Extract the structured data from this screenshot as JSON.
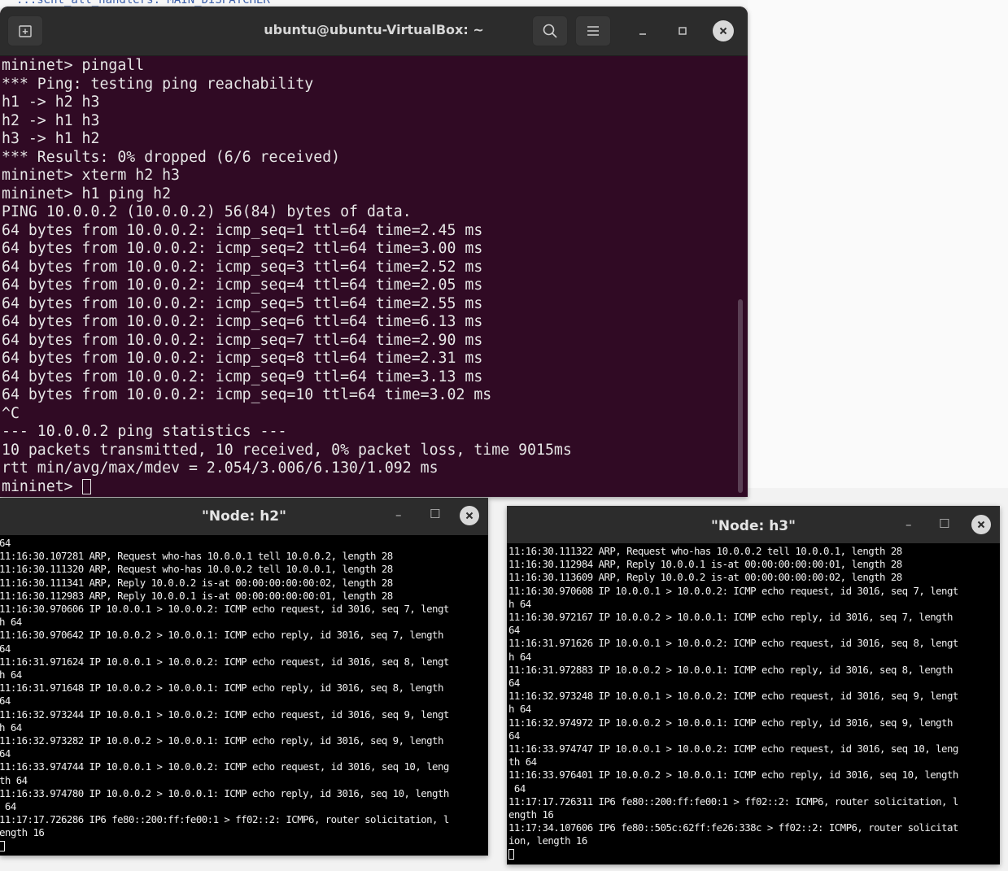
{
  "background": {
    "partial_text": "...sent_all_handlers: MAIN_DISPATCHER"
  },
  "terminal": {
    "title": "ubuntu@ubuntu-VirtualBox: ~",
    "lines": [
      "mininet> pingall",
      "*** Ping: testing ping reachability",
      "h1 -> h2 h3",
      "h2 -> h1 h3",
      "h3 -> h1 h2",
      "*** Results: 0% dropped (6/6 received)",
      "mininet> xterm h2 h3",
      "mininet> h1 ping h2",
      "PING 10.0.0.2 (10.0.0.2) 56(84) bytes of data.",
      "64 bytes from 10.0.0.2: icmp_seq=1 ttl=64 time=2.45 ms",
      "64 bytes from 10.0.0.2: icmp_seq=2 ttl=64 time=3.00 ms",
      "64 bytes from 10.0.0.2: icmp_seq=3 ttl=64 time=2.52 ms",
      "64 bytes from 10.0.0.2: icmp_seq=4 ttl=64 time=2.05 ms",
      "64 bytes from 10.0.0.2: icmp_seq=5 ttl=64 time=2.55 ms",
      "64 bytes from 10.0.0.2: icmp_seq=6 ttl=64 time=6.13 ms",
      "64 bytes from 10.0.0.2: icmp_seq=7 ttl=64 time=2.90 ms",
      "64 bytes from 10.0.0.2: icmp_seq=8 ttl=64 time=2.31 ms",
      "64 bytes from 10.0.0.2: icmp_seq=9 ttl=64 time=3.13 ms",
      "64 bytes from 10.0.0.2: icmp_seq=10 ttl=64 time=3.02 ms",
      "^C",
      "--- 10.0.0.2 ping statistics ---",
      "10 packets transmitted, 10 received, 0% packet loss, time 9015ms",
      "rtt min/avg/max/mdev = 2.054/3.006/6.130/1.092 ms"
    ],
    "prompt": "mininet> ",
    "colors": {
      "background": "#300a24",
      "header": "#2c2c2c",
      "text": "#e6e6e6"
    }
  },
  "xterm_h2": {
    "title": "\"Node: h2\"",
    "lines": [
      "64",
      "11:16:30.107281 ARP, Request who-has 10.0.0.1 tell 10.0.0.2, length 28",
      "11:16:30.111320 ARP, Request who-has 10.0.0.2 tell 10.0.0.1, length 28",
      "11:16:30.111341 ARP, Reply 10.0.0.2 is-at 00:00:00:00:00:02, length 28",
      "11:16:30.112983 ARP, Reply 10.0.0.1 is-at 00:00:00:00:00:01, length 28",
      "11:16:30.970606 IP 10.0.0.1 > 10.0.0.2: ICMP echo request, id 3016, seq 7, lengt",
      "h 64",
      "11:16:30.970642 IP 10.0.0.2 > 10.0.0.1: ICMP echo reply, id 3016, seq 7, length",
      "64",
      "11:16:31.971624 IP 10.0.0.1 > 10.0.0.2: ICMP echo request, id 3016, seq 8, lengt",
      "h 64",
      "11:16:31.971648 IP 10.0.0.2 > 10.0.0.1: ICMP echo reply, id 3016, seq 8, length",
      "64",
      "11:16:32.973244 IP 10.0.0.1 > 10.0.0.2: ICMP echo request, id 3016, seq 9, lengt",
      "h 64",
      "11:16:32.973282 IP 10.0.0.2 > 10.0.0.1: ICMP echo reply, id 3016, seq 9, length",
      "64",
      "11:16:33.974744 IP 10.0.0.1 > 10.0.0.2: ICMP echo request, id 3016, seq 10, leng",
      "th 64",
      "11:16:33.974780 IP 10.0.0.2 > 10.0.0.1: ICMP echo reply, id 3016, seq 10, length",
      " 64",
      "11:17:17.726286 IP6 fe80::200:ff:fe00:1 > ff02::2: ICMP6, router solicitation, l",
      "ength 16"
    ]
  },
  "xterm_h3": {
    "title": "\"Node: h3\"",
    "lines": [
      "11:16:30.111322 ARP, Request who-has 10.0.0.2 tell 10.0.0.1, length 28",
      "11:16:30.112984 ARP, Reply 10.0.0.1 is-at 00:00:00:00:00:01, length 28",
      "11:16:30.113609 ARP, Reply 10.0.0.2 is-at 00:00:00:00:00:02, length 28",
      "11:16:30.970608 IP 10.0.0.1 > 10.0.0.2: ICMP echo request, id 3016, seq 7, lengt",
      "h 64",
      "11:16:30.972167 IP 10.0.0.2 > 10.0.0.1: ICMP echo reply, id 3016, seq 7, length",
      "64",
      "11:16:31.971626 IP 10.0.0.1 > 10.0.0.2: ICMP echo request, id 3016, seq 8, lengt",
      "h 64",
      "11:16:31.972883 IP 10.0.0.2 > 10.0.0.1: ICMP echo reply, id 3016, seq 8, length",
      "64",
      "11:16:32.973248 IP 10.0.0.1 > 10.0.0.2: ICMP echo request, id 3016, seq 9, lengt",
      "h 64",
      "11:16:32.974972 IP 10.0.0.2 > 10.0.0.1: ICMP echo reply, id 3016, seq 9, length",
      "64",
      "11:16:33.974747 IP 10.0.0.1 > 10.0.0.2: ICMP echo request, id 3016, seq 10, leng",
      "th 64",
      "11:16:33.976401 IP 10.0.0.2 > 10.0.0.1: ICMP echo reply, id 3016, seq 10, length",
      " 64",
      "11:17:17.726311 IP6 fe80::200:ff:fe00:1 > ff02::2: ICMP6, router solicitation, l",
      "ength 16",
      "11:17:34.107606 IP6 fe80::505c:62ff:fe26:338c > ff02::2: ICMP6, router solicitat",
      "ion, length 16"
    ]
  },
  "icons": [
    "new-tab-icon",
    "search-icon",
    "hamburger-menu-icon",
    "minimize-icon",
    "maximize-icon",
    "close-icon"
  ]
}
